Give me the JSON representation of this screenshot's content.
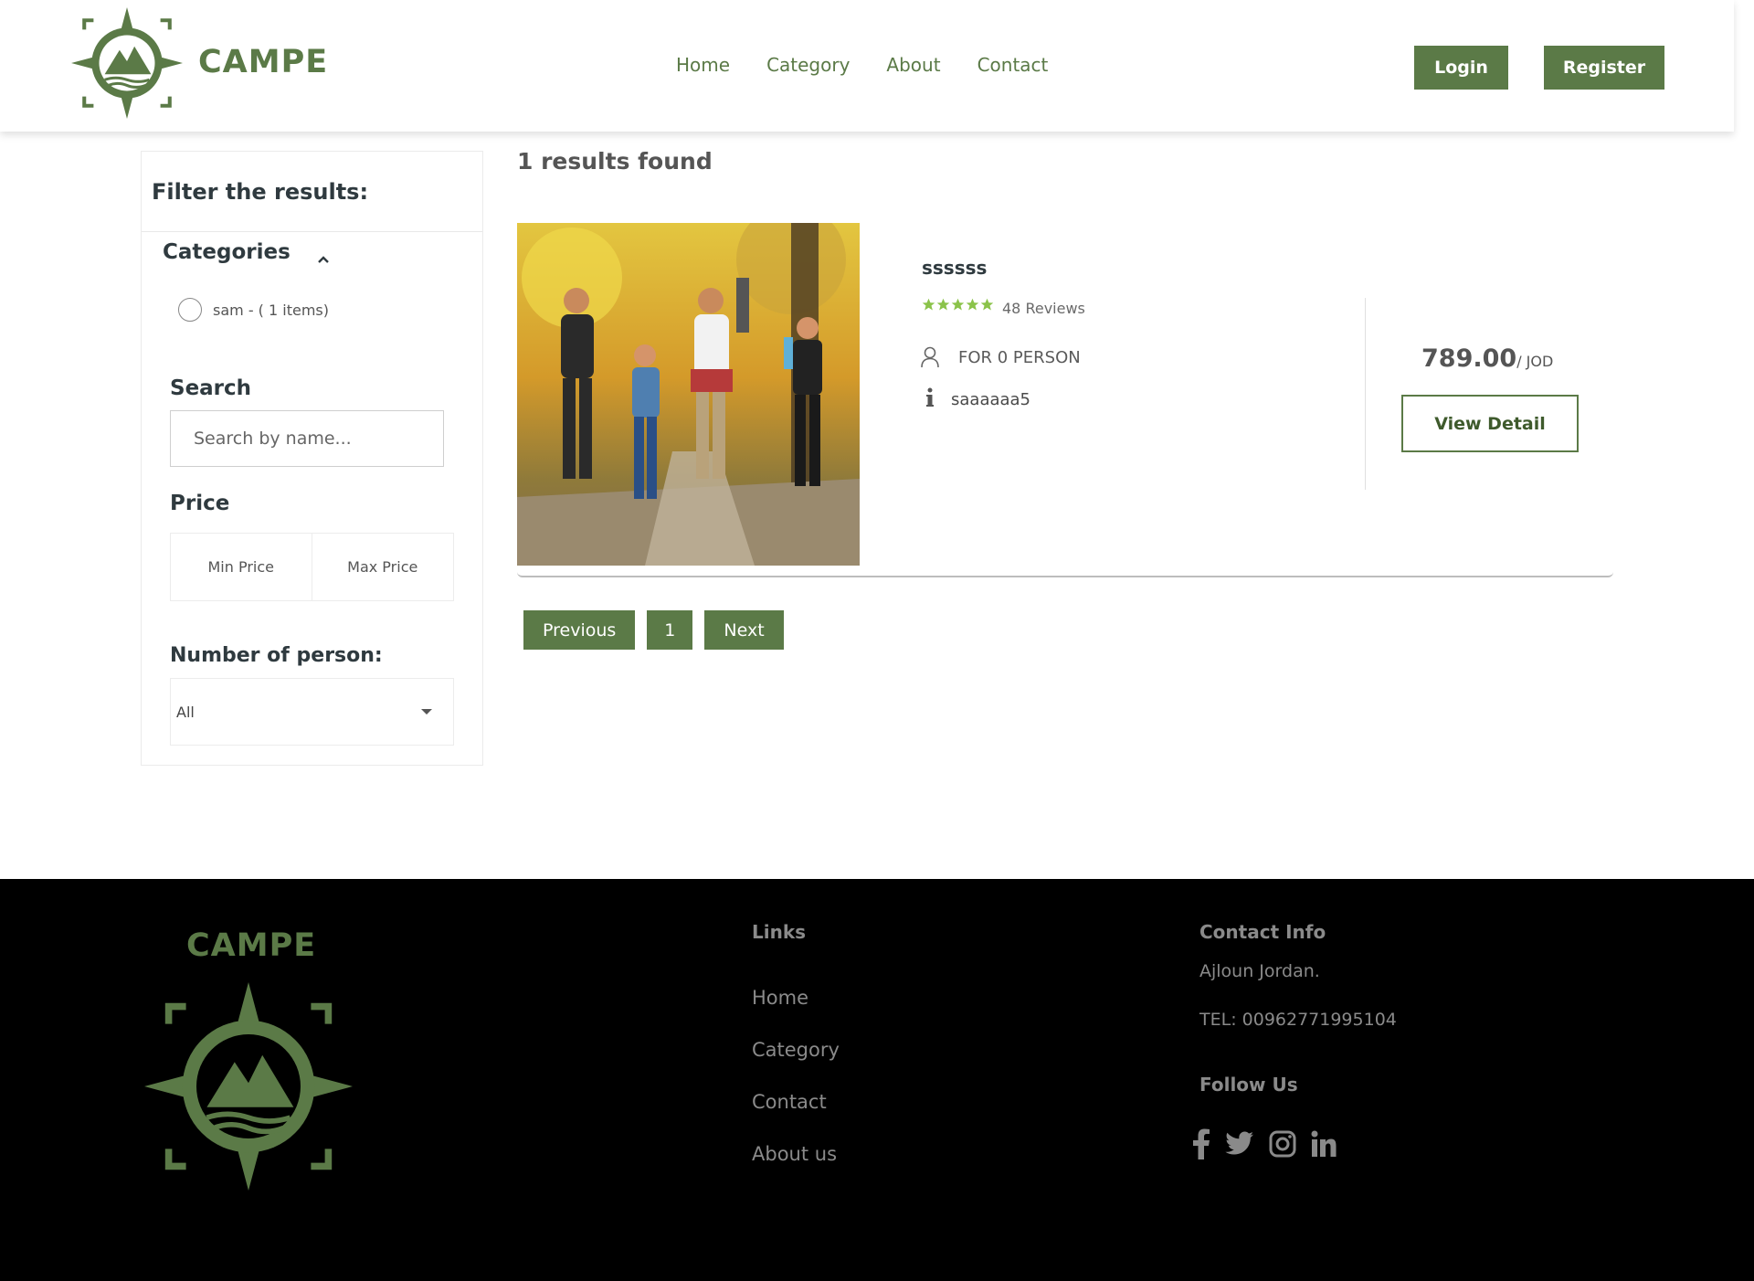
{
  "header": {
    "brand": "CAMPE",
    "nav": [
      "Home",
      "Category",
      "About",
      "Contact"
    ],
    "login_label": "Login",
    "register_label": "Register",
    "accent_color": "#5b7a47"
  },
  "sidebar": {
    "filter_title": "Filter the results:",
    "categories_title": "Categories",
    "categories": [
      {
        "label": "sam - ( 1 items)"
      }
    ],
    "search_title": "Search",
    "search_placeholder": "Search by name...",
    "price_title": "Price",
    "min_price_placeholder": "Min Price",
    "max_price_placeholder": "Max Price",
    "persons_title": "Number of person:",
    "persons_value": "All"
  },
  "results": {
    "count_text": "1 results found",
    "items": [
      {
        "name": "ssssss",
        "rating_stars": 5,
        "reviews": "48 Reviews",
        "persons": "FOR 0 PERSON",
        "info": "saaaaaa5",
        "price": "789.00",
        "currency": "/ JOD",
        "detail_label": "View Detail"
      }
    ]
  },
  "pagination": {
    "previous": "Previous",
    "current": "1",
    "next": "Next"
  },
  "footer": {
    "brand": "CAMPE",
    "links_title": "Links",
    "links": [
      "Home",
      "Category",
      "Contact",
      "About us"
    ],
    "contact_title": "Contact Info",
    "address": "Ajloun Jordan.",
    "phone": "TEL: 00962771995104",
    "follow_title": "Follow Us",
    "social_icons": [
      "facebook-icon",
      "twitter-icon",
      "instagram-icon",
      "linkedin-icon"
    ]
  }
}
